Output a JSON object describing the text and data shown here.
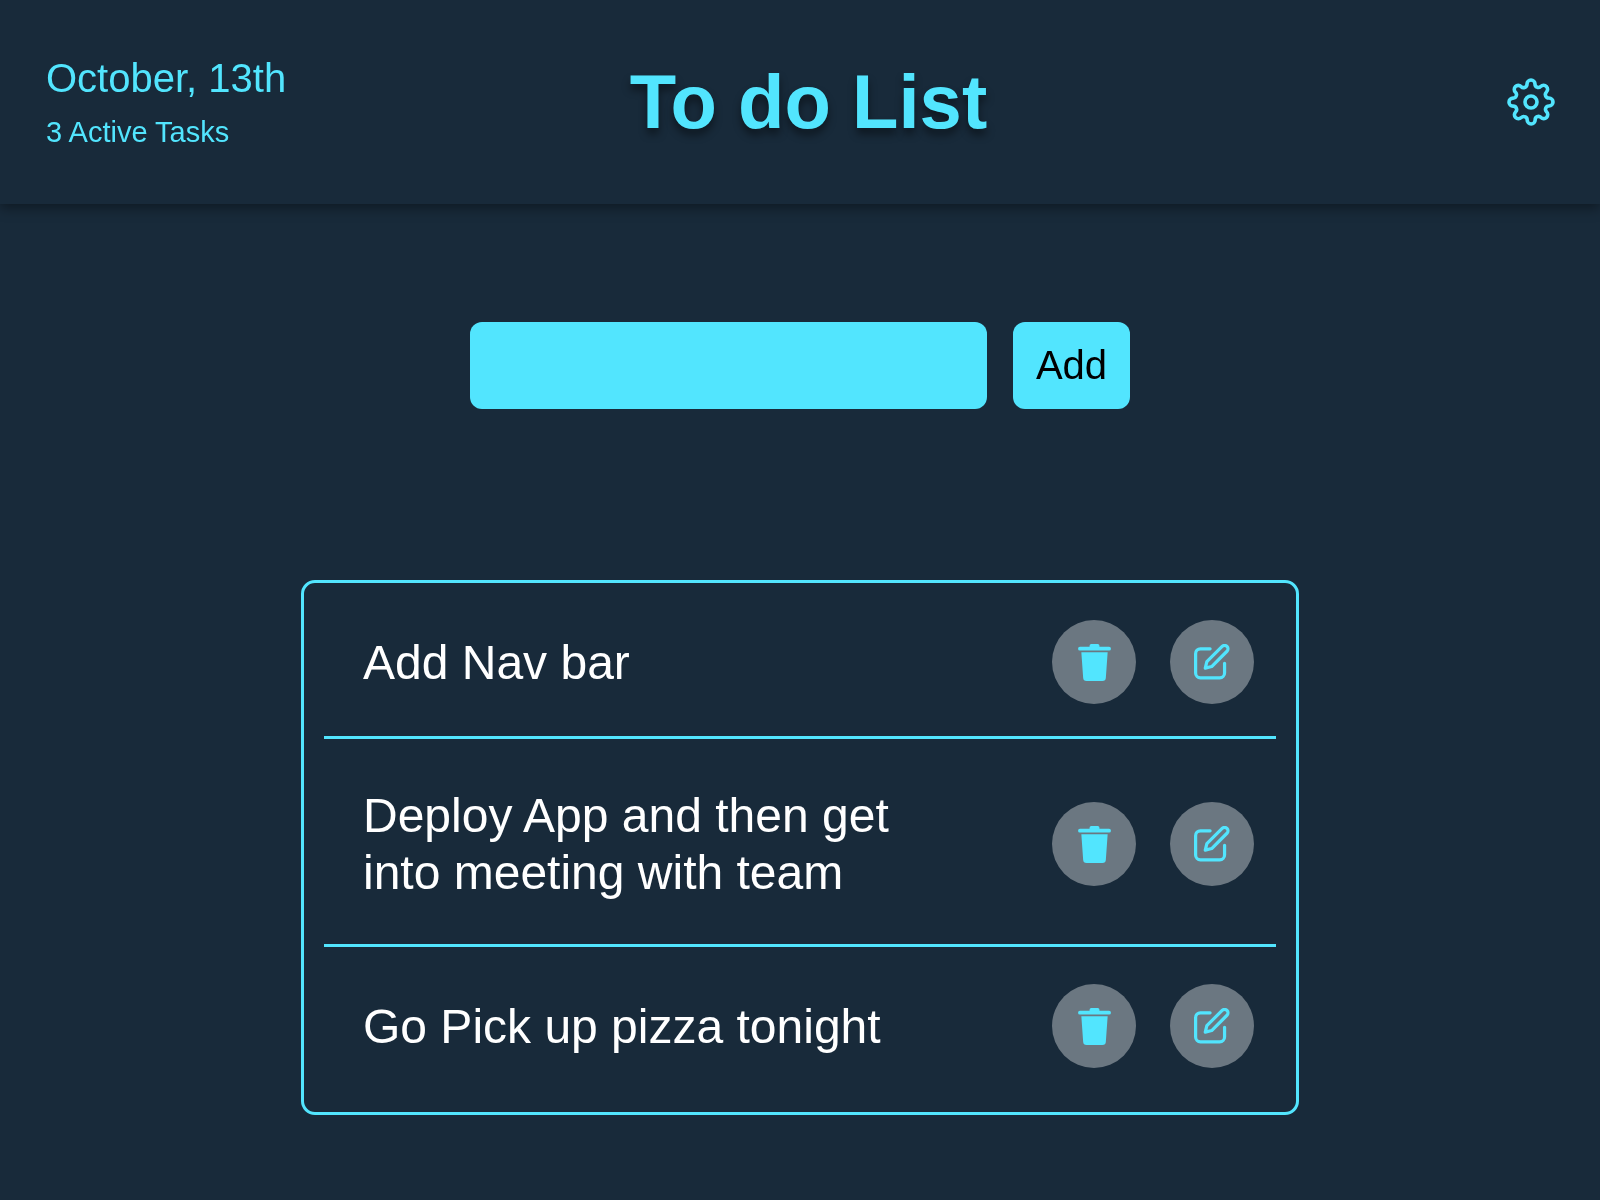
{
  "header": {
    "date": "October, 13th",
    "summary": "3 Active Tasks",
    "title": "To do List"
  },
  "entry": {
    "button": "Add"
  },
  "tasks": [
    {
      "text": "Add Nav bar"
    },
    {
      "text": "Deploy App and then get into meeting with team"
    },
    {
      "text": "Go Pick up pizza tonight"
    }
  ]
}
